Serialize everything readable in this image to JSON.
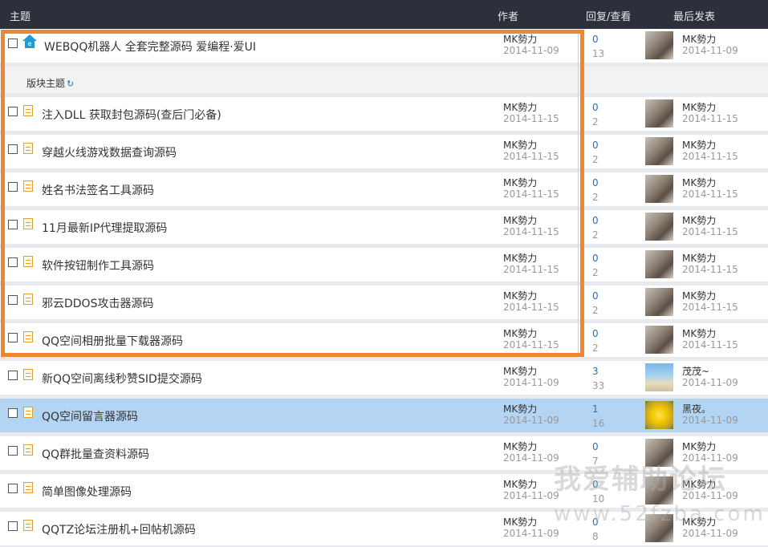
{
  "header": {
    "topic": "主题",
    "author": "作者",
    "reply_view": "回复/查看",
    "last_post": "最后发表"
  },
  "first_row": {
    "title": "WEBQQ机器人 全套完整源码 爱编程·爱UI",
    "author": "MK勢力",
    "date": "2014-11-09",
    "replies": "0",
    "views": "13",
    "last_user": "MK勢力",
    "last_date": "2014-11-09"
  },
  "section": {
    "label": "版块主题"
  },
  "threads": [
    {
      "title": "注入DLL 获取封包源码(查后门必备)",
      "author": "MK勢力",
      "date": "2014-11-15",
      "replies": "0",
      "views": "2",
      "last_user": "MK勢力",
      "last_date": "2014-11-15"
    },
    {
      "title": "穿越火线游戏数据查询源码",
      "author": "MK勢力",
      "date": "2014-11-15",
      "replies": "0",
      "views": "2",
      "last_user": "MK勢力",
      "last_date": "2014-11-15"
    },
    {
      "title": "姓名书法签名工具源码",
      "author": "MK勢力",
      "date": "2014-11-15",
      "replies": "0",
      "views": "2",
      "last_user": "MK勢力",
      "last_date": "2014-11-15"
    },
    {
      "title": "11月最新IP代理提取源码",
      "author": "MK勢力",
      "date": "2014-11-15",
      "replies": "0",
      "views": "2",
      "last_user": "MK勢力",
      "last_date": "2014-11-15"
    },
    {
      "title": "软件按钮制作工具源码",
      "author": "MK勢力",
      "date": "2014-11-15",
      "replies": "0",
      "views": "2",
      "last_user": "MK勢力",
      "last_date": "2014-11-15"
    },
    {
      "title": "邪云DDOS攻击器源码",
      "author": "MK勢力",
      "date": "2014-11-15",
      "replies": "0",
      "views": "2",
      "last_user": "MK勢力",
      "last_date": "2014-11-15"
    },
    {
      "title": "QQ空间相册批量下载器源码",
      "author": "MK勢力",
      "date": "2014-11-15",
      "replies": "0",
      "views": "2",
      "last_user": "MK勢力",
      "last_date": "2014-11-15"
    },
    {
      "title": "新QQ空间离线秒赞SID提交源码",
      "author": "MK勢力",
      "date": "2014-11-09",
      "replies": "3",
      "views": "33",
      "last_user": "茂茂~",
      "last_date": "2014-11-09"
    },
    {
      "title": "QQ空间留言器源码",
      "author": "MK勢力",
      "date": "2014-11-09",
      "replies": "1",
      "views": "16",
      "last_user": "黑夜。",
      "last_date": "2014-11-09"
    },
    {
      "title": "QQ群批量查资料源码",
      "author": "MK勢力",
      "date": "2014-11-09",
      "replies": "0",
      "views": "7",
      "last_user": "MK勢力",
      "last_date": "2014-11-09"
    },
    {
      "title": "简单图像处理源码",
      "author": "MK勢力",
      "date": "2014-11-09",
      "replies": "0",
      "views": "10",
      "last_user": "MK勢力",
      "last_date": "2014-11-09"
    },
    {
      "title": "QQTZ论坛注册机+回帖机源码",
      "author": "MK勢力",
      "date": "2014-11-09",
      "replies": "0",
      "views": "8",
      "last_user": "MK勢力",
      "last_date": "2014-11-09"
    }
  ],
  "watermark": {
    "line1": "我爱辅助论坛",
    "line2": "www.52fzba.com"
  },
  "colors": {
    "header_bg": "#2b303b",
    "highlight_box": "#f0862f",
    "selected_row": "#b3d4f2",
    "reply_count": "#2a6fb8"
  }
}
